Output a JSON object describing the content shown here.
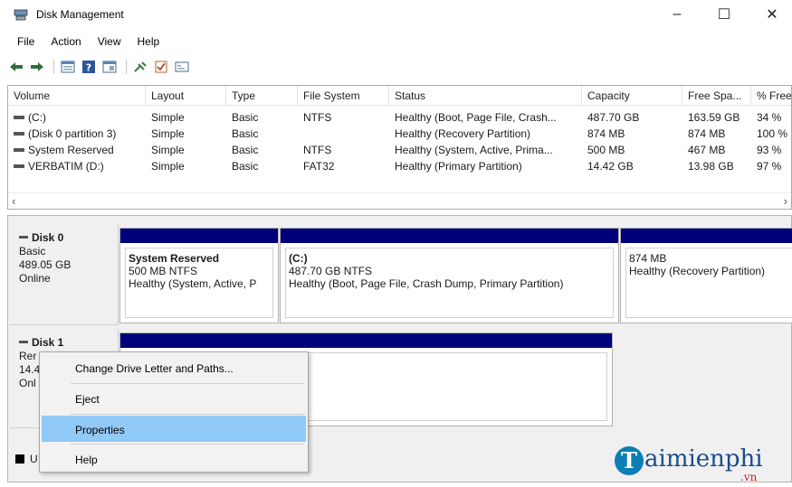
{
  "window": {
    "title": "Disk Management",
    "minimize": "–",
    "maximize": "☐",
    "close": "✕"
  },
  "menu": [
    "File",
    "Action",
    "View",
    "Help"
  ],
  "volumes": {
    "columns": [
      "Volume",
      "Layout",
      "Type",
      "File System",
      "Status",
      "Capacity",
      "Free Spa...",
      "% Free"
    ],
    "rows": [
      [
        "(C:)",
        "Simple",
        "Basic",
        "NTFS",
        "Healthy (Boot, Page File, Crash...",
        "487.70 GB",
        "163.59 GB",
        "34 %"
      ],
      [
        "(Disk 0 partition 3)",
        "Simple",
        "Basic",
        "",
        "Healthy (Recovery Partition)",
        "874 MB",
        "874 MB",
        "100 %"
      ],
      [
        "System Reserved",
        "Simple",
        "Basic",
        "NTFS",
        "Healthy (System, Active, Prima...",
        "500 MB",
        "467 MB",
        "93 %"
      ],
      [
        "VERBATIM (D:)",
        "Simple",
        "Basic",
        "FAT32",
        "Healthy (Primary Partition)",
        "14.42 GB",
        "13.98 GB",
        "97 %"
      ]
    ]
  },
  "disk0": {
    "name": "Disk 0",
    "type": "Basic",
    "size": "489.05 GB",
    "state": "Online",
    "partitions": [
      {
        "name": "System Reserved",
        "size": "500 MB NTFS",
        "status": "Healthy (System, Active, P"
      },
      {
        "name": "(C:)",
        "size": "487.70 GB NTFS",
        "status": "Healthy (Boot, Page File, Crash Dump, Primary Partition)"
      },
      {
        "name": "",
        "size": "874 MB",
        "status": "Healthy (Recovery Partition)"
      }
    ]
  },
  "disk1": {
    "name": "Disk 1",
    "type": "Rer",
    "size": "14.4",
    "state": "Onl"
  },
  "unallocated_label": "U",
  "context_menu": {
    "items": [
      "Change Drive Letter and Paths...",
      "Eject",
      "Properties",
      "Help"
    ],
    "highlighted": "Properties"
  },
  "watermark": {
    "initial": "T",
    "name": "aimienphi",
    "tld": ".vn"
  }
}
